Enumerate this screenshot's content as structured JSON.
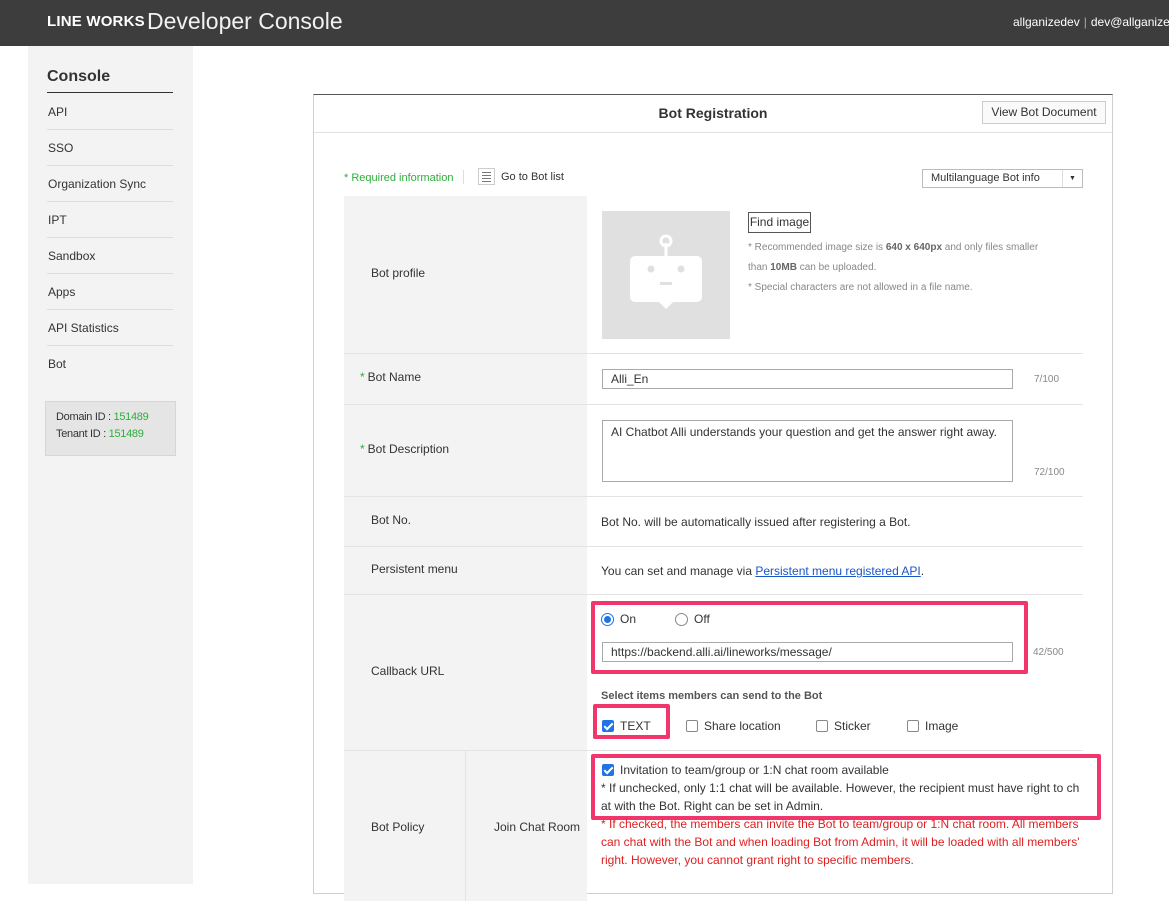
{
  "header": {
    "brand": "LINE WORKS",
    "title": "Developer Console",
    "account_user": "allganizedev",
    "account_email": "dev@allganize"
  },
  "sidebar": {
    "title": "Console",
    "items": [
      {
        "label": "API"
      },
      {
        "label": "SSO"
      },
      {
        "label": "Organization Sync"
      },
      {
        "label": "IPT"
      },
      {
        "label": "Sandbox"
      },
      {
        "label": "Apps"
      },
      {
        "label": "API Statistics"
      },
      {
        "label": "Bot"
      }
    ],
    "domain_label": "Domain ID : ",
    "domain_id": "151489",
    "tenant_label": "Tenant ID : ",
    "tenant_id": "151489"
  },
  "page": {
    "title": "Bot Registration",
    "doc_button": "View Bot Document",
    "required_info": "* Required information",
    "bot_list_link": "Go to Bot list",
    "multilang_select": "Multilanguage Bot info"
  },
  "form": {
    "profile": {
      "label": "Bot profile",
      "find_button": "Find image",
      "hint1_pre": "* Recommended image size is ",
      "hint1_size": "640 x 640px",
      "hint1_post": " and only files smaller",
      "hint2_pre": "than ",
      "hint2_size": "10MB",
      "hint2_post": " can be uploaded.",
      "hint3": "* Special characters are not allowed in a file name."
    },
    "name": {
      "required": "*",
      "label": "Bot Name",
      "value": "Alli_En",
      "counter": "7/100"
    },
    "description": {
      "required": "*",
      "label": "Bot Description",
      "value": "AI Chatbot Alli understands your question and get the answer right away.",
      "counter": "72/100"
    },
    "bot_no": {
      "label": "Bot No.",
      "text": "Bot No. will be automatically issued after registering a Bot."
    },
    "persistent_menu": {
      "label": "Persistent menu",
      "text_pre": "You can set and manage via ",
      "link": "Persistent menu registered API",
      "text_post": "."
    },
    "callback": {
      "label": "Callback URL",
      "on_label": "On",
      "off_label": "Off",
      "url": "https://backend.alli.ai/lineworks/message/",
      "counter": "42/500",
      "items_title": "Select items members can send to the Bot",
      "items": [
        {
          "label": "TEXT",
          "checked": true
        },
        {
          "label": "Share location",
          "checked": false
        },
        {
          "label": "Sticker",
          "checked": false
        },
        {
          "label": "Image",
          "checked": false
        }
      ]
    },
    "policy": {
      "label": "Bot Policy",
      "sub_label": "Join Chat Room",
      "checkbox_label": "Invitation to team/group or 1:N chat room available",
      "note_line1": "* If unchecked, only 1:1 chat will be available. However, the recipient must have right to ch",
      "note_line2": "at with the Bot. Right can be set in Admin.",
      "red_line1": "* If checked, the members can invite the Bot to team/group or 1:N chat room. All members",
      "red_line2": "can chat with the Bot and when loading Bot from Admin, it will be loaded with all members'",
      "red_line3": "right. However, you cannot grant right to specific members."
    }
  },
  "colors": {
    "topbar": "#3d3d3d",
    "required_green": "#2eae3a",
    "highlight": "#f0366a",
    "link_blue": "#1a55c6",
    "warning_red": "#e02020"
  }
}
